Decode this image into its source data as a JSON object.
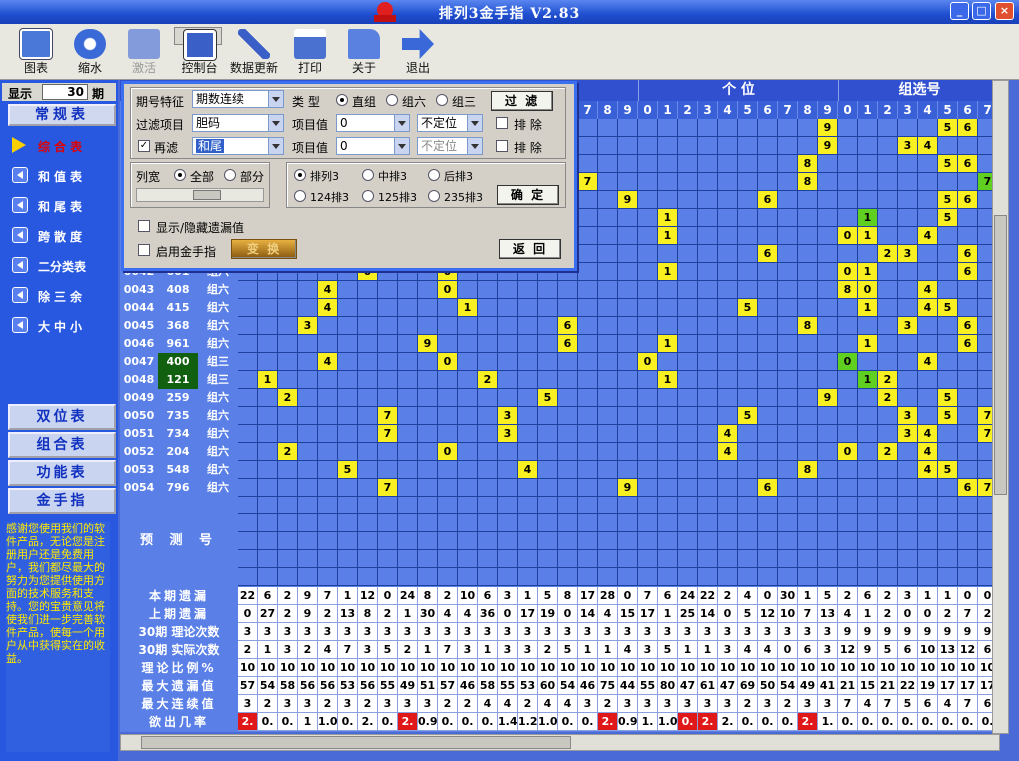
{
  "window": {
    "title": "排列3金手指   V2.83",
    "minimize": "_",
    "maximize": "□",
    "close": "×"
  },
  "toolbar": [
    {
      "label": "图表",
      "icon": "chart-icon"
    },
    {
      "label": "缩水",
      "icon": "gears-icon"
    },
    {
      "label": "激活",
      "icon": "activate-icon"
    },
    {
      "label": "控制台",
      "icon": "console-icon"
    },
    {
      "label": "数据更新",
      "icon": "wrench-icon"
    },
    {
      "label": "打印",
      "icon": "printer-icon"
    },
    {
      "label": "关于",
      "icon": "folder-icon"
    },
    {
      "label": "退出",
      "icon": "exit-arrow-icon"
    }
  ],
  "sidebar": {
    "show_label": "显示",
    "show_value": "30",
    "show_unit": "期",
    "section": "常规表",
    "items": [
      "综合表",
      "和值表",
      "和尾表",
      "跨散度",
      "二分类表",
      "除三余",
      "大中小"
    ],
    "big_buttons": [
      "双位表",
      "组合表",
      "功能表",
      "金手指"
    ],
    "message": "感谢您使用我们的软件产品，无论您是注册用户还是免费用户，我们都尽最大的努力为您提供使用方面的技术服务和支持。您的宝贵意见将使我们进一步完善软件产品，使每一个用户从中获得实在的收益。"
  },
  "grid": {
    "header_groups": {
      "ge": "个  位",
      "zu": "组选号"
    },
    "header_digits_left": [
      "7",
      "8",
      "9"
    ],
    "header_digits_ge": [
      "0",
      "1",
      "2",
      "3",
      "4",
      "5",
      "6",
      "7",
      "8",
      "9"
    ],
    "header_digits_zu": [
      "0",
      "1",
      "2",
      "3",
      "4",
      "5",
      "6",
      "7"
    ],
    "rows": [
      {
        "id": "0042",
        "num": "601",
        "type": "组六"
      },
      {
        "id": "0043",
        "num": "408",
        "type": "组六"
      },
      {
        "id": "0044",
        "num": "415",
        "type": "组六"
      },
      {
        "id": "0045",
        "num": "368",
        "type": "组六"
      },
      {
        "id": "0046",
        "num": "961",
        "type": "组六"
      },
      {
        "id": "0047",
        "num": "400",
        "type": "组三",
        "green": true
      },
      {
        "id": "0048",
        "num": "121",
        "type": "组三",
        "green": true
      },
      {
        "id": "0049",
        "num": "259",
        "type": "组六"
      },
      {
        "id": "0050",
        "num": "735",
        "type": "组六"
      },
      {
        "id": "0051",
        "num": "734",
        "type": "组六"
      },
      {
        "id": "0052",
        "num": "204",
        "type": "组六"
      },
      {
        "id": "0053",
        "num": "548",
        "type": "组六"
      },
      {
        "id": "0054",
        "num": "796",
        "type": "组六"
      }
    ],
    "predict_label": "预 测 号",
    "stats": [
      {
        "label": "本期遗漏",
        "values": [
          "22",
          "6",
          "2",
          "9",
          "7",
          "1",
          "12",
          "0",
          "24",
          "8",
          "2",
          "10",
          "6",
          "3",
          "1",
          "5",
          "8",
          "17",
          "28",
          "0",
          "7",
          "6",
          "24",
          "22",
          "2",
          "4",
          "0",
          "30",
          "1",
          "5",
          "2",
          "6",
          "2",
          "3",
          "1",
          "1",
          "0",
          "0"
        ]
      },
      {
        "label": "上期遗漏",
        "values": [
          "0",
          "27",
          "2",
          "9",
          "2",
          "13",
          "8",
          "2",
          "1",
          "30",
          "4",
          "4",
          "36",
          "0",
          "17",
          "19",
          "0",
          "14",
          "4",
          "15",
          "17",
          "1",
          "25",
          "14",
          "0",
          "5",
          "12",
          "10",
          "7",
          "13",
          "4",
          "1",
          "2",
          "0",
          "0",
          "2",
          "7",
          "2"
        ]
      },
      {
        "label": "30期 理论次数",
        "values": [
          "3",
          "3",
          "3",
          "3",
          "3",
          "3",
          "3",
          "3",
          "3",
          "3",
          "3",
          "3",
          "3",
          "3",
          "3",
          "3",
          "3",
          "3",
          "3",
          "3",
          "3",
          "3",
          "3",
          "3",
          "3",
          "3",
          "3",
          "3",
          "3",
          "3",
          "9",
          "9",
          "9",
          "9",
          "9",
          "9",
          "9",
          "9"
        ]
      },
      {
        "label": "30期 实际次数",
        "values": [
          "2",
          "1",
          "3",
          "2",
          "4",
          "7",
          "3",
          "5",
          "2",
          "1",
          "7",
          "3",
          "1",
          "3",
          "3",
          "2",
          "5",
          "1",
          "1",
          "4",
          "3",
          "5",
          "1",
          "1",
          "3",
          "4",
          "4",
          "0",
          "6",
          "3",
          "12",
          "9",
          "5",
          "6",
          "10",
          "13",
          "12",
          "6"
        ]
      },
      {
        "label": "理论比例%",
        "values": [
          "10",
          "10",
          "10",
          "10",
          "10",
          "10",
          "10",
          "10",
          "10",
          "10",
          "10",
          "10",
          "10",
          "10",
          "10",
          "10",
          "10",
          "10",
          "10",
          "10",
          "10",
          "10",
          "10",
          "10",
          "10",
          "10",
          "10",
          "10",
          "10",
          "10",
          "10",
          "10",
          "10",
          "10",
          "10",
          "10",
          "10",
          "10"
        ]
      },
      {
        "label": "最大遗漏值",
        "values": [
          "57",
          "54",
          "58",
          "56",
          "56",
          "53",
          "56",
          "55",
          "49",
          "51",
          "57",
          "46",
          "58",
          "55",
          "53",
          "60",
          "54",
          "46",
          "75",
          "44",
          "55",
          "80",
          "47",
          "61",
          "47",
          "69",
          "50",
          "54",
          "49",
          "41",
          "21",
          "15",
          "21",
          "22",
          "19",
          "17",
          "17",
          "17"
        ]
      },
      {
        "label": "最大连续值",
        "values": [
          "3",
          "2",
          "3",
          "3",
          "2",
          "3",
          "2",
          "3",
          "3",
          "3",
          "2",
          "2",
          "4",
          "4",
          "2",
          "4",
          "4",
          "3",
          "2",
          "3",
          "3",
          "3",
          "3",
          "3",
          "3",
          "2",
          "3",
          "2",
          "3",
          "3",
          "7",
          "4",
          "7",
          "5",
          "6",
          "4",
          "7",
          "6"
        ]
      },
      {
        "label": "欲出几率",
        "values": [
          "2.",
          "0.",
          "0.",
          "1",
          "1.0",
          "0.",
          "2.",
          "0.",
          "2.",
          "0.9",
          "0.",
          "0.",
          "0.",
          "1.4",
          "1.2",
          "1.0",
          "0.",
          "0.",
          "2.",
          "0.9",
          "1.",
          "1.0",
          "0.",
          "2.",
          "2.",
          "0.",
          "0.",
          "0.",
          "2.",
          "1.",
          "0.",
          "0.",
          "0.",
          "0.",
          "0.",
          "0.",
          "0.",
          "0."
        ]
      }
    ]
  },
  "dialog": {
    "period_feature_label": "期号特征",
    "period_feature_value": "期数连续",
    "type_label": "类 型",
    "types": [
      "直组",
      "组六",
      "组三"
    ],
    "filter_button": "过 滤",
    "filter_item_label": "过滤项目",
    "filter_item_value": "胆码",
    "item_value_label": "项目值",
    "item_value_1": "0",
    "position_1": "不定位",
    "exclude_label": "排 除",
    "refilter_label": "再滤",
    "refilter_value": "和尾",
    "item_value_2": "0",
    "position_2": "不定位",
    "exclude_label_2": "排 除",
    "column_width_label": "列宽",
    "col_all": "全部",
    "col_part": "部分",
    "arrangements": [
      "排列3",
      "中排3",
      "后排3",
      "124排3",
      "125排3",
      "235排3"
    ],
    "confirm_button": "确 定",
    "show_hide_label": "显示/隐藏遗漏值",
    "enable_label": "启用金手指",
    "change_button": "变 换",
    "back_button": "返 回"
  },
  "colors": {
    "grid_bg": "#5a80e8",
    "hit": "#f8f020",
    "double": "#60d020",
    "red": "#e01818"
  }
}
